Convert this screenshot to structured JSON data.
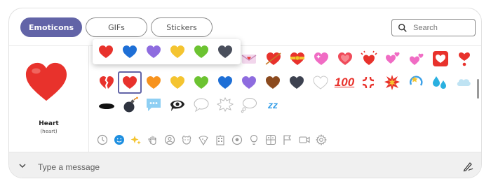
{
  "tabs": [
    {
      "label": "Emoticons",
      "active": true
    },
    {
      "label": "GIFs",
      "active": false
    },
    {
      "label": "Stickers",
      "active": false
    }
  ],
  "search": {
    "placeholder": "Search"
  },
  "preview": {
    "name": "Heart",
    "code": "(heart)"
  },
  "popup_variants": [
    {
      "icon": "red-heart",
      "color": "#e8322c"
    },
    {
      "icon": "blue-heart",
      "color": "#1e6fd6"
    },
    {
      "icon": "purple-heart",
      "color": "#8e6cdf"
    },
    {
      "icon": "yellow-heart",
      "color": "#f4c430"
    },
    {
      "icon": "green-heart",
      "color": "#6cc331"
    },
    {
      "icon": "black-heart",
      "color": "#4a4f5c"
    }
  ],
  "grid": {
    "row1": [
      "love-letter",
      "heart-with-arrow",
      "heart-with-ribbon",
      "sparkling-heart",
      "growing-heart",
      "beating-heart",
      "revolving-hearts",
      "two-hearts",
      "heart-decoration",
      "heart-exclamation"
    ],
    "row2": [
      "broken-heart",
      "red-heart",
      "orange-heart",
      "yellow-heart",
      "green-heart",
      "blue-heart",
      "purple-heart",
      "brown-heart",
      "black-heart",
      "white-heart",
      "hundred-points",
      "anger-symbol",
      "collision",
      "dizzy",
      "sweat-droplets",
      "dashing-away"
    ],
    "row3": [
      "hole",
      "bomb",
      "speech-balloon",
      "eye-in-speech-bubble",
      "left-speech-bubble",
      "right-anger-bubble",
      "thought-balloon",
      "zzz"
    ],
    "hundred_text": "100",
    "zzz_text": "zz"
  },
  "categories": [
    "recent-icon",
    "smiley-icon",
    "sparkle-icon",
    "hand-icon",
    "person-icon",
    "animal-icon",
    "food-icon",
    "building-icon",
    "ball-icon",
    "bulb-icon",
    "symbols-icon",
    "flag-icon",
    "video-icon",
    "gear-icon"
  ],
  "colors": {
    "accent": "#6264a7",
    "heart_red": "#e8322c"
  },
  "compose": {
    "placeholder": "Type a message"
  }
}
